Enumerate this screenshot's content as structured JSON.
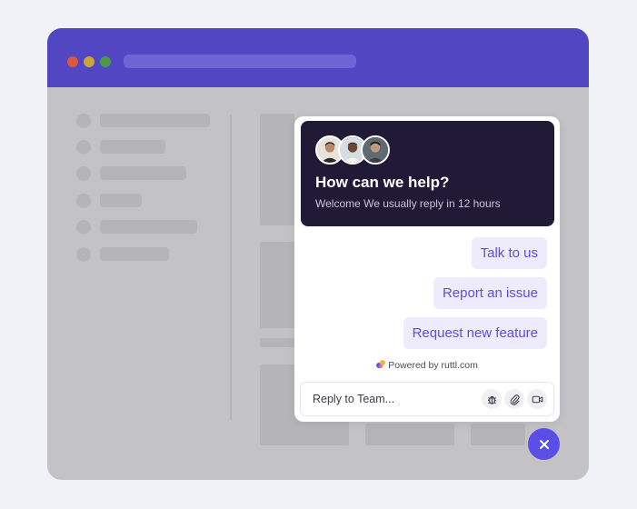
{
  "chat": {
    "title": "How can we help?",
    "subtitle": "Welcome We usually reply in 12 hours",
    "avatars": [
      "agent-1-avatar",
      "agent-2-avatar",
      "agent-3-avatar"
    ],
    "actions": [
      {
        "label": "Talk to us"
      },
      {
        "label": "Report an issue"
      },
      {
        "label": "Request new feature"
      }
    ],
    "powered_by": "Powered by ruttl.com",
    "reply": {
      "placeholder": "Reply to Team...",
      "tools": [
        "bug-icon",
        "paperclip-icon",
        "video-icon"
      ]
    },
    "close_icon": "close-icon"
  },
  "colors": {
    "accent": "#5b4ee6",
    "header_dark": "#201a36",
    "titlebar": "#5346c3",
    "action_bg": "#eeebfd",
    "action_text": "#5f4fd6"
  }
}
